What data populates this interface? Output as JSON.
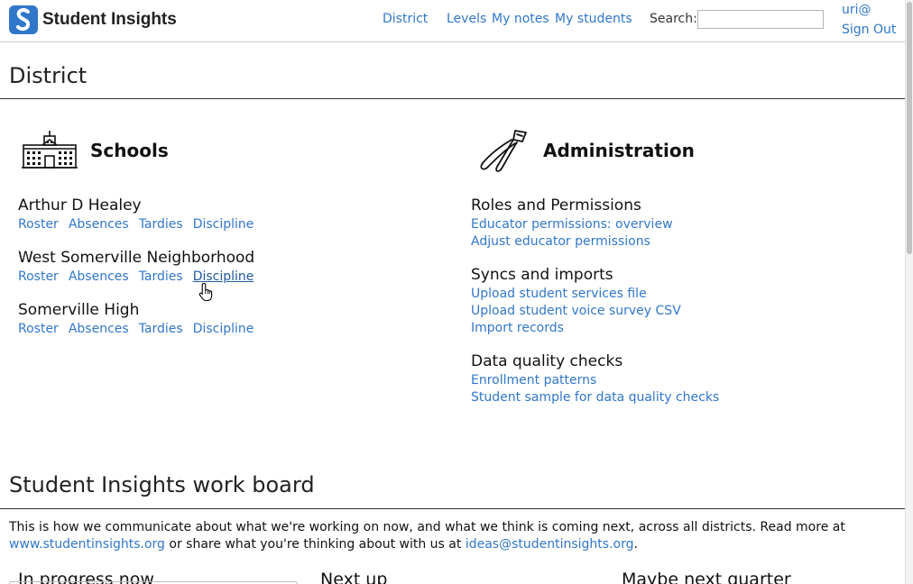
{
  "header": {
    "app_title": "Student Insights",
    "nav": [
      {
        "label": "District"
      },
      {
        "label": "Levels"
      },
      {
        "label": "My notes"
      },
      {
        "label": "My students"
      }
    ],
    "search_label": "Search:",
    "search_value": "",
    "user": "uri@",
    "sign_out": "Sign Out"
  },
  "page_title": "District",
  "schools": {
    "heading": "Schools",
    "items": [
      {
        "name": "Arthur D Healey",
        "links": [
          "Roster",
          "Absences",
          "Tardies",
          "Discipline"
        ]
      },
      {
        "name": "West Somerville Neighborhood",
        "links": [
          "Roster",
          "Absences",
          "Tardies",
          "Discipline"
        ]
      },
      {
        "name": "Somerville High",
        "links": [
          "Roster",
          "Absences",
          "Tardies",
          "Discipline"
        ]
      }
    ]
  },
  "administration": {
    "heading": "Administration",
    "groups": [
      {
        "title": "Roles and Permissions",
        "links": [
          "Educator permissions: overview",
          "Adjust educator permissions"
        ]
      },
      {
        "title": "Syncs and imports",
        "links": [
          "Upload student services file",
          "Upload student voice survey CSV",
          "Import records"
        ]
      },
      {
        "title": "Data quality checks",
        "links": [
          "Enrollment patterns",
          "Student sample for data quality checks"
        ]
      }
    ]
  },
  "workboard": {
    "title": "Student Insights work board",
    "desc_1": "This is how we communicate about what we're working on now, and what we think is coming next, across all districts. Read more at",
    "link_site": "www.studentinsights.org",
    "desc_2": " or share what you're thinking about with us at ",
    "link_email": "ideas@studentinsights.org",
    "desc_3": ".",
    "columns": [
      "In progress now",
      "Next up",
      "Maybe next quarter"
    ]
  },
  "colors": {
    "link": "#3177c9",
    "brand": "#3177c9"
  }
}
